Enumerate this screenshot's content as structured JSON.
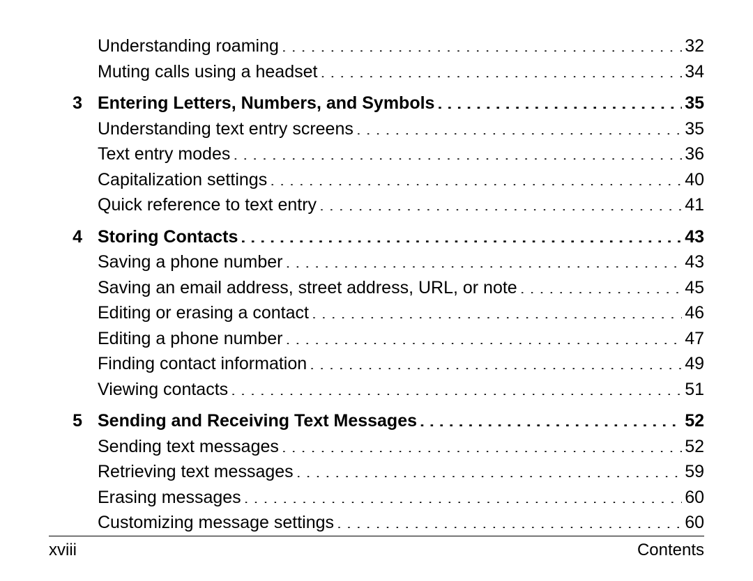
{
  "orphan_subs": [
    {
      "title": "Understanding roaming",
      "page": "32"
    },
    {
      "title": "Muting calls using a headset",
      "page": "34"
    }
  ],
  "chapters": [
    {
      "num": "3",
      "title": "Entering Letters, Numbers, and Symbols",
      "page": "35",
      "subs": [
        {
          "title": "Understanding text entry screens",
          "page": "35"
        },
        {
          "title": "Text entry modes",
          "page": "36"
        },
        {
          "title": "Capitalization settings",
          "page": "40"
        },
        {
          "title": "Quick reference to text entry",
          "page": "41"
        }
      ]
    },
    {
      "num": "4",
      "title": "Storing Contacts",
      "page": "43",
      "subs": [
        {
          "title": "Saving a phone number",
          "page": "43"
        },
        {
          "title": "Saving an email address, street address, URL, or note",
          "page": "45"
        },
        {
          "title": "Editing or erasing a contact",
          "page": "46"
        },
        {
          "title": "Editing a phone number",
          "page": "47"
        },
        {
          "title": "Finding contact information",
          "page": "49"
        },
        {
          "title": "Viewing contacts",
          "page": "51"
        }
      ]
    },
    {
      "num": "5",
      "title": "Sending and Receiving Text Messages",
      "page": "52",
      "subs": [
        {
          "title": "Sending text messages",
          "page": "52"
        },
        {
          "title": "Retrieving text messages",
          "page": "59"
        },
        {
          "title": "Erasing messages",
          "page": "60"
        },
        {
          "title": "Customizing message settings",
          "page": "60"
        }
      ]
    }
  ],
  "footer": {
    "left": "xviii",
    "right": "Contents"
  }
}
